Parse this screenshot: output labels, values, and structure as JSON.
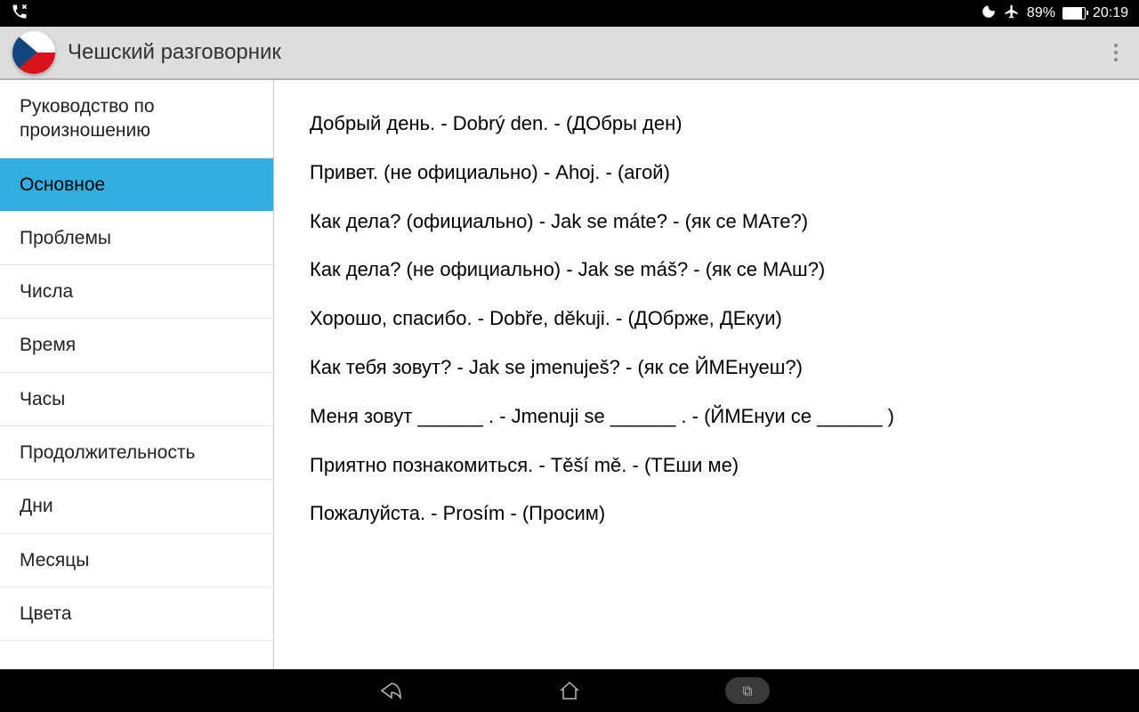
{
  "status": {
    "battery_pct": "89%",
    "time": "20:19"
  },
  "header": {
    "title": "Чешский разговорник"
  },
  "sidebar": {
    "items": [
      {
        "label": "Руководство по произношению",
        "active": false
      },
      {
        "label": "Основное",
        "active": true
      },
      {
        "label": "Проблемы",
        "active": false
      },
      {
        "label": "Числа",
        "active": false
      },
      {
        "label": "Время",
        "active": false
      },
      {
        "label": "Часы",
        "active": false
      },
      {
        "label": "Продолжительность",
        "active": false
      },
      {
        "label": "Дни",
        "active": false
      },
      {
        "label": "Месяцы",
        "active": false
      },
      {
        "label": "Цвета",
        "active": false
      }
    ]
  },
  "content": {
    "phrases": [
      "Добрый день. - Dobrý den. - (ДОбры ден)",
      "Привет. (не официально) - Ahoj. - (агой)",
      "Как дела? (официально) - Jak se máte? - (як се МАте?)",
      "Как дела? (не официально) - Jak se máš? - (як се МАш?)",
      "Хорошо, спасибо. - Dobře, děkuji. - (ДОбрже, ДЕкуи)",
      "Как тебя зовут? - Jak se jmenuješ? - (як се ЙМЕнуеш?)",
      "Меня зовут ______ . - Jmenuji se ______ . - (ЙМЕнуи се ______ )",
      "Приятно познакомиться. - Těší mě. - (ТЕши ме)",
      "Пожалуйста. - Prosím - (Просим)"
    ]
  }
}
